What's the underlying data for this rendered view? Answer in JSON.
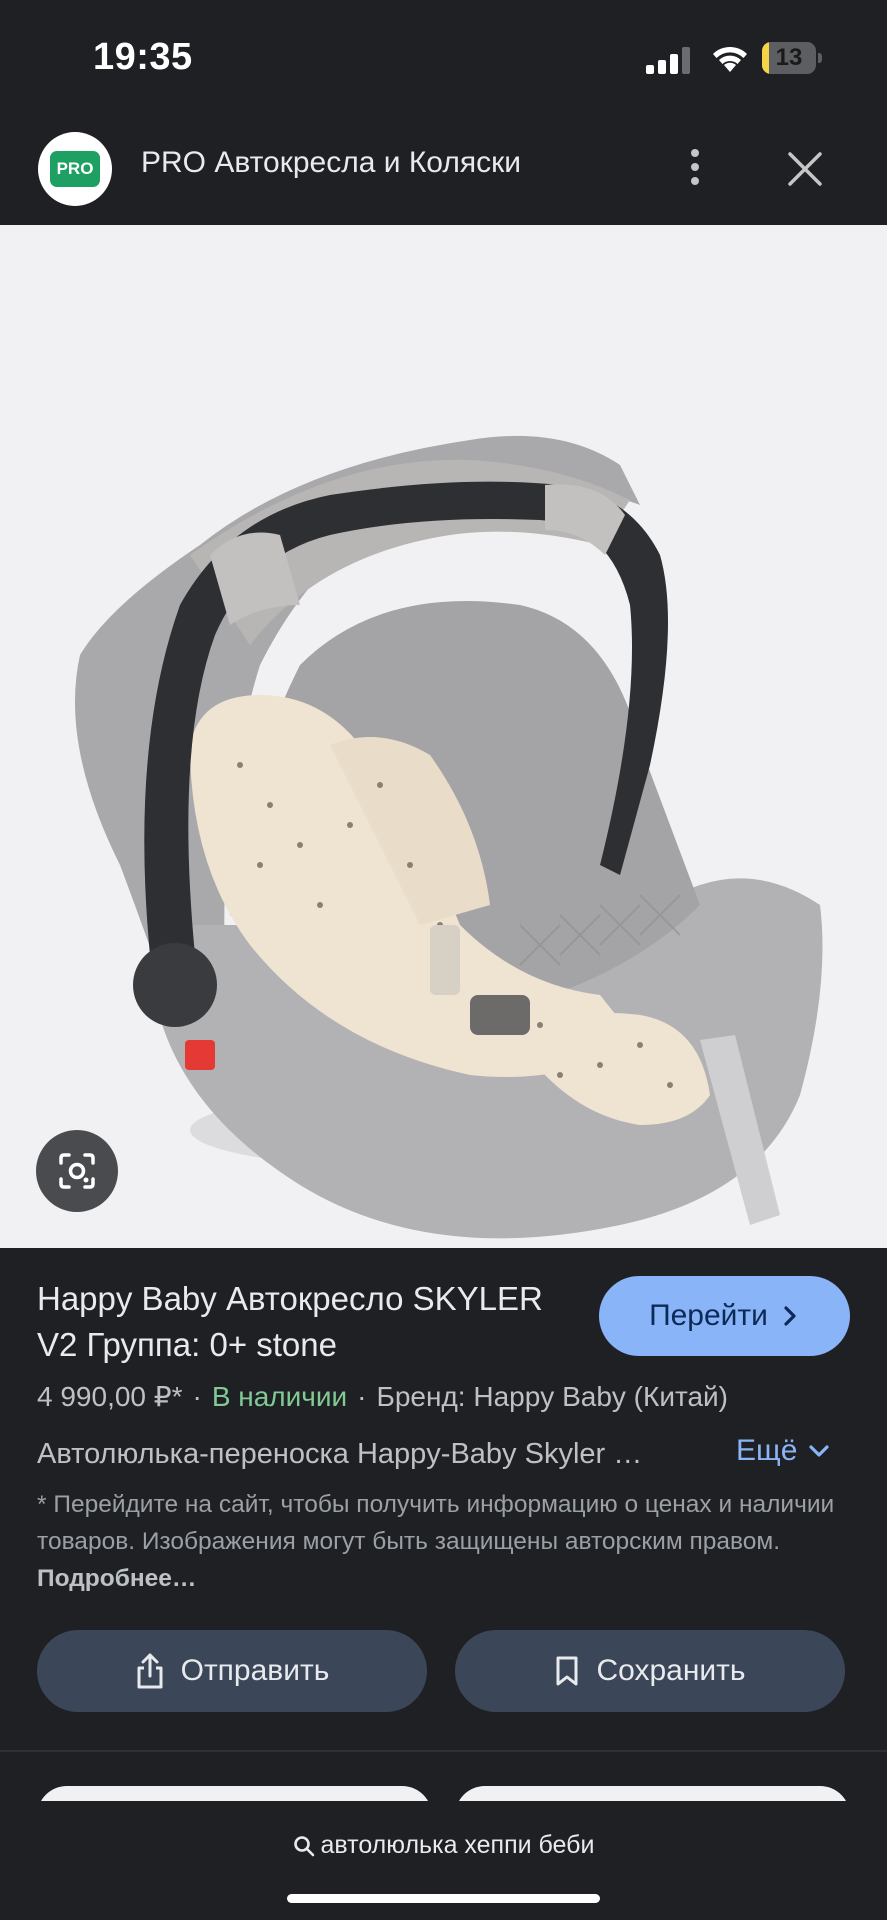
{
  "status": {
    "time": "19:35",
    "battery": "13",
    "battery_level": 0.13
  },
  "header": {
    "logo_text": "PRO",
    "title": "PRO Автокресла и Коляски"
  },
  "product": {
    "title": "Happy Baby Автокресло SKYLER V2 Группа: 0+ stone",
    "visit_label": "Перейти",
    "price": "4 990,00 ₽*",
    "separator": "·",
    "availability": "В наличии",
    "brand": "Бренд: Happy Baby (Китай)",
    "description": "Автолюлька-переноска Happy-Baby Skyler …",
    "more_label": "Ещё",
    "disclaimer": "* Перейдите на сайт, чтобы получить информацию о ценах и наличии товаров. Изображения могут быть защищены авторским правом.",
    "disclaimer_link": "Подробнее…"
  },
  "actions": {
    "share_label": "Отправить",
    "save_label": "Сохранить"
  },
  "search": {
    "query": "автолюлька хеппи беби"
  },
  "colors": {
    "accent": "#8ab4f8",
    "in_stock": "#81c995",
    "logo_green": "#1ea063",
    "background": "#1f2023"
  },
  "icons": [
    "more-vert-icon",
    "close-icon",
    "lens-icon",
    "chevron-right-icon",
    "chevron-down-icon",
    "share-icon",
    "bookmark-icon",
    "search-icon"
  ]
}
